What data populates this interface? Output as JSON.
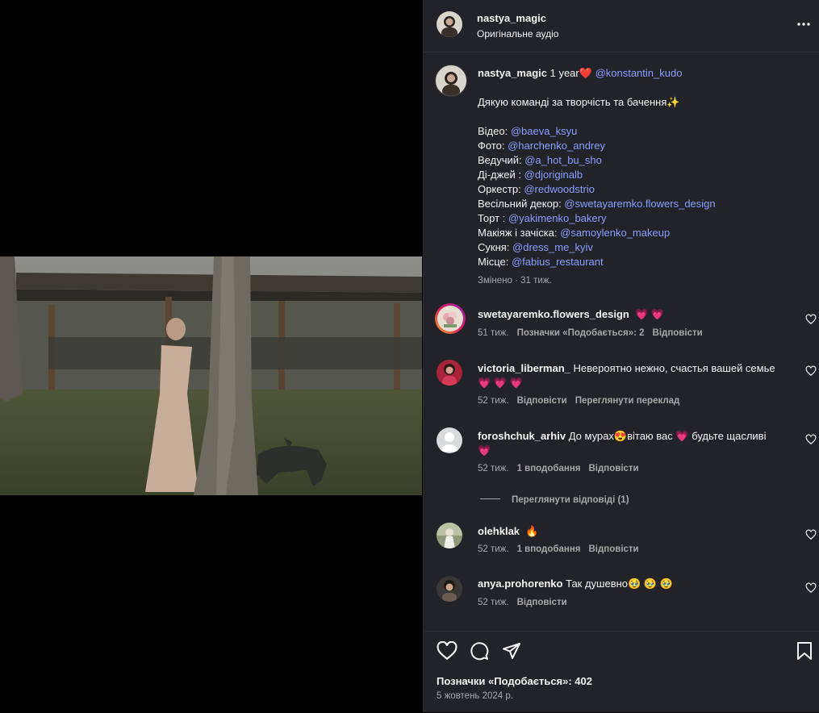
{
  "header": {
    "username": "nastya_magic",
    "audio": "Оригінальне аудіо",
    "more": "•••"
  },
  "caption": {
    "username": "nastya_magic",
    "text_after_name": " 1 year",
    "heart": "❤️",
    "mention_main": "@konstantin_kudo",
    "thanks": "Дякую команді за творчість та бачення",
    "sparkle": "✨",
    "credits": [
      {
        "role": "Відео: ",
        "handle": "@baeva_ksyu"
      },
      {
        "role": "Фото: ",
        "handle": "@harchenko_andrey"
      },
      {
        "role": "Ведучий: ",
        "handle": "@a_hot_bu_sho"
      },
      {
        "role": "Ді-джей : ",
        "handle": "@djoriginalb"
      },
      {
        "role": "Оркестр: ",
        "handle": "@redwoodstrio"
      },
      {
        "role": "Весільний декор: ",
        "handle": "@swetayaremko.flowers_design"
      },
      {
        "role": "Торт : ",
        "handle": "@yakimenko_bakery"
      },
      {
        "role": "Макіяж і зачіска: ",
        "handle": "@samoylenko_makeup"
      },
      {
        "role": "Сукня: ",
        "handle": "@dress_me_kyiv"
      },
      {
        "role": "Місце: ",
        "handle": "@fabius_restaurant"
      }
    ],
    "edited": "Змінено · 31 тиж."
  },
  "comments": [
    {
      "username": "swetayaremko.flowers_design",
      "text": "",
      "emoji": "💗 💗",
      "time": "51 тиж.",
      "likes": "Позначки «Подобається»: 2",
      "reply": "Відповісти",
      "translate": ""
    },
    {
      "username": "victoria_liberman_",
      "text": " Невероятно нежно, счастья вашей семье",
      "emoji": "💗 💗 💗",
      "time": "52 тиж.",
      "likes": "",
      "reply": "Відповісти",
      "translate": "Переглянути переклад"
    },
    {
      "username": "foroshchuk_arhiv",
      "text": " До мурах",
      "text2": "вітаю вас ",
      "text3": " будьте щасливі",
      "emoji_a": "😍",
      "emoji_b": "💗",
      "emoji_c": "💗",
      "time": "52 тиж.",
      "likes": "1 вподобання",
      "reply": "Відповісти",
      "view_replies": "Переглянути відповіді (1)"
    },
    {
      "username": "olehklak",
      "text": " ",
      "emoji": "🔥",
      "time": "52 тиж.",
      "likes": "1 вподобання",
      "reply": "Відповісти"
    },
    {
      "username": "anya.prohorenko",
      "text": " Так душевно",
      "emoji": "🥹 🥹 🥹",
      "time": "52 тиж.",
      "likes": "",
      "reply": "Відповісти"
    }
  ],
  "footer": {
    "likes_count": "Позначки «Подобається»: 402",
    "date": "5 жовтень 2024 р."
  },
  "colors": {
    "panel_bg": "#212328",
    "mention": "#8c9dff",
    "heart": "#ff3040",
    "muted": "#a8a8a8"
  }
}
